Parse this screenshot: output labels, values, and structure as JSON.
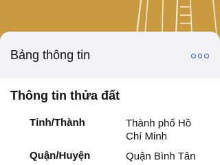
{
  "panel": {
    "title": "Bảng thông tin",
    "more_icon": "more-horizontal-icon",
    "accent_color": "#2a5bd7"
  },
  "parcel_info": {
    "section_title": "Thông tin thửa đất",
    "rows": [
      {
        "label": "Tỉnh/Thành",
        "value": "Thành phố Hồ Chí Minh"
      },
      {
        "label": "Quận/Huyện",
        "value": "Quận Bình Tân"
      }
    ]
  },
  "map": {
    "parcel_color": "#c99a3f",
    "boundary_color": "#f5f0e6"
  }
}
